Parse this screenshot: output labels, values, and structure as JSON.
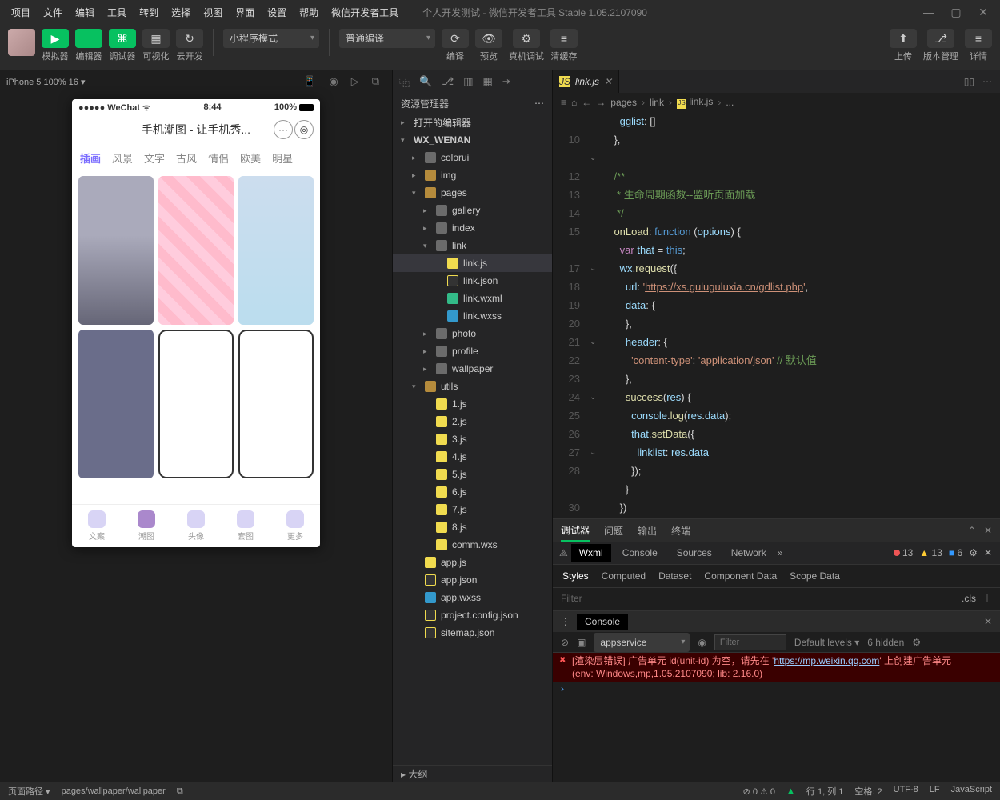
{
  "menubar": {
    "items": [
      "项目",
      "文件",
      "编辑",
      "工具",
      "转到",
      "选择",
      "视图",
      "界面",
      "设置",
      "帮助",
      "微信开发者工具"
    ],
    "title": "个人开发测试 - 微信开发者工具 Stable 1.05.2107090"
  },
  "toolbar": {
    "buttons": [
      {
        "name": "simulator",
        "label": "模拟器",
        "glyph": "▶",
        "cls": "green"
      },
      {
        "name": "editor",
        "label": "编辑器",
        "glyph": "</>",
        "cls": "green"
      },
      {
        "name": "debugger",
        "label": "调试器",
        "glyph": "⌘",
        "cls": "green"
      },
      {
        "name": "visualize",
        "label": "可视化",
        "glyph": "▦",
        "cls": "gray"
      },
      {
        "name": "cloud",
        "label": "云开发",
        "glyph": "↻",
        "cls": "gray"
      }
    ],
    "mode": "小程序模式",
    "compile": "普通编译",
    "mid": [
      {
        "name": "compile-btn",
        "label": "编译",
        "glyph": "⟳"
      },
      {
        "name": "preview-btn",
        "label": "预览",
        "glyph": "👁"
      },
      {
        "name": "remote-btn",
        "label": "真机调试",
        "glyph": "⚙"
      },
      {
        "name": "cache-btn",
        "label": "清缓存",
        "glyph": "≡"
      }
    ],
    "right": [
      {
        "name": "upload-btn",
        "label": "上传",
        "glyph": "⬆"
      },
      {
        "name": "version-btn",
        "label": "版本管理",
        "glyph": "⎇"
      },
      {
        "name": "detail-btn",
        "label": "详情",
        "glyph": "≡"
      }
    ]
  },
  "simulator": {
    "device": "iPhone 5 100% 16 ▾",
    "phone": {
      "carrier": "●●●●● WeChat ᯤ",
      "time": "8:44",
      "battery": "100%",
      "title": "手机潮图 - 让手机秀...",
      "tabs": [
        "插画",
        "风景",
        "文字",
        "古风",
        "情侣",
        "欧美",
        "明星"
      ],
      "tabbar": [
        "文案",
        "潮图",
        "头像",
        "套图",
        "更多"
      ]
    }
  },
  "files": {
    "header": "资源管理器",
    "nodes": [
      {
        "d": 0,
        "c": "▸",
        "t": "打开的编辑器",
        "cls": ""
      },
      {
        "d": 0,
        "c": "▾",
        "t": "WX_WENAN",
        "cls": "",
        "bold": true
      },
      {
        "d": 1,
        "c": "▸",
        "t": "colorui",
        "cls": "ic-folder"
      },
      {
        "d": 1,
        "c": "▸",
        "t": "img",
        "cls": "ic-folder-o"
      },
      {
        "d": 1,
        "c": "▾",
        "t": "pages",
        "cls": "ic-folder-o"
      },
      {
        "d": 2,
        "c": "▸",
        "t": "gallery",
        "cls": "ic-folder"
      },
      {
        "d": 2,
        "c": "▸",
        "t": "index",
        "cls": "ic-folder"
      },
      {
        "d": 2,
        "c": "▾",
        "t": "link",
        "cls": "ic-folder"
      },
      {
        "d": 3,
        "c": "",
        "t": "link.js",
        "cls": "ic-js",
        "cur": true
      },
      {
        "d": 3,
        "c": "",
        "t": "link.json",
        "cls": "ic-json"
      },
      {
        "d": 3,
        "c": "",
        "t": "link.wxml",
        "cls": "ic-wxml"
      },
      {
        "d": 3,
        "c": "",
        "t": "link.wxss",
        "cls": "ic-wxss"
      },
      {
        "d": 2,
        "c": "▸",
        "t": "photo",
        "cls": "ic-folder"
      },
      {
        "d": 2,
        "c": "▸",
        "t": "profile",
        "cls": "ic-folder"
      },
      {
        "d": 2,
        "c": "▸",
        "t": "wallpaper",
        "cls": "ic-folder"
      },
      {
        "d": 1,
        "c": "▾",
        "t": "utils",
        "cls": "ic-folder-o"
      },
      {
        "d": 2,
        "c": "",
        "t": "1.js",
        "cls": "ic-js"
      },
      {
        "d": 2,
        "c": "",
        "t": "2.js",
        "cls": "ic-js"
      },
      {
        "d": 2,
        "c": "",
        "t": "3.js",
        "cls": "ic-js"
      },
      {
        "d": 2,
        "c": "",
        "t": "4.js",
        "cls": "ic-js"
      },
      {
        "d": 2,
        "c": "",
        "t": "5.js",
        "cls": "ic-js"
      },
      {
        "d": 2,
        "c": "",
        "t": "6.js",
        "cls": "ic-js"
      },
      {
        "d": 2,
        "c": "",
        "t": "7.js",
        "cls": "ic-js"
      },
      {
        "d": 2,
        "c": "",
        "t": "8.js",
        "cls": "ic-js"
      },
      {
        "d": 2,
        "c": "",
        "t": "comm.wxs",
        "cls": "ic-wxs"
      },
      {
        "d": 1,
        "c": "",
        "t": "app.js",
        "cls": "ic-js"
      },
      {
        "d": 1,
        "c": "",
        "t": "app.json",
        "cls": "ic-json"
      },
      {
        "d": 1,
        "c": "",
        "t": "app.wxss",
        "cls": "ic-wxss"
      },
      {
        "d": 1,
        "c": "",
        "t": "project.config.json",
        "cls": "ic-json"
      },
      {
        "d": 1,
        "c": "",
        "t": "sitemap.json",
        "cls": "ic-json"
      }
    ],
    "outline": "▸ 大纲"
  },
  "editor": {
    "tab": "link.js",
    "crumbs": [
      "pages",
      "link",
      "link.js",
      "..."
    ],
    "lines": [
      "",
      "10",
      "",
      "12",
      "13",
      "14",
      "15",
      "",
      "17",
      "18",
      "19",
      "20",
      "21",
      "22",
      "23",
      "24",
      "25",
      "26",
      "27",
      "28",
      "",
      "30"
    ],
    "folds": {
      "2": "⌄",
      "8": "⌄",
      "12": "⌄",
      "15": "⌄",
      "18": "⌄"
    },
    "code": [
      "      <span class='c-v'>gglist</span><span class='c-p'>: []</span>",
      "    <span class='c-p'>},</span>",
      "",
      "    <span class='c-c'>/**</span>",
      "<span class='c-c'>     * 生命周期函数--监听页面加载</span>",
      "<span class='c-c'>     */</span>",
      "    <span class='c-f'>onLoad</span><span class='c-p'>: </span><span class='c-t'>function</span> <span class='c-p'>(</span><span class='c-v'>options</span><span class='c-p'>) {</span>",
      "      <span class='c-k'>var</span> <span class='c-v'>that</span> <span class='c-p'>=</span> <span class='c-t'>this</span><span class='c-p'>;</span>",
      "      <span class='c-v'>wx</span><span class='c-p'>.</span><span class='c-f'>request</span><span class='c-p'>({</span>",
      "        <span class='c-v'>url</span><span class='c-p'>: </span><span class='c-s'>'</span><span class='c-url'>https://xs.guluguluxia.cn/gdlist.php</span><span class='c-s'>'</span><span class='c-p'>,</span>",
      "        <span class='c-v'>data</span><span class='c-p'>: {</span>",
      "        <span class='c-p'>},</span>",
      "        <span class='c-v'>header</span><span class='c-p'>: {</span>",
      "          <span class='c-s'>'content-type'</span><span class='c-p'>: </span><span class='c-s'>'application/json'</span> <span class='c-c'>// 默认值</span>",
      "        <span class='c-p'>},</span>",
      "        <span class='c-f'>success</span><span class='c-p'>(</span><span class='c-v'>res</span><span class='c-p'>) {</span>",
      "          <span class='c-v'>console</span><span class='c-p'>.</span><span class='c-f'>log</span><span class='c-p'>(</span><span class='c-v'>res</span><span class='c-p'>.</span><span class='c-v'>data</span><span class='c-p'>);</span>",
      "          <span class='c-v'>that</span><span class='c-p'>.</span><span class='c-f'>setData</span><span class='c-p'>({</span>",
      "            <span class='c-v'>linklist</span><span class='c-p'>: </span><span class='c-v'>res</span><span class='c-p'>.</span><span class='c-v'>data</span>",
      "          <span class='c-p'>});</span>",
      "        <span class='c-p'>}</span>",
      "      <span class='c-p'>})</span>"
    ]
  },
  "debugger": {
    "tabs": [
      "调试器",
      "问题",
      "输出",
      "终端"
    ],
    "devtabs": [
      "Wxml",
      "Console",
      "Sources",
      "Network"
    ],
    "stats": {
      "err": "13",
      "warn": "13",
      "info": "6"
    },
    "styletabs": [
      "Styles",
      "Computed",
      "Dataset",
      "Component Data",
      "Scope Data"
    ],
    "filter": "Filter",
    "cls": ".cls",
    "console": {
      "title": "Console",
      "context": "appservice",
      "filter": "Filter",
      "levels": "Default levels ▾",
      "hidden": "6 hidden",
      "err1": "[渲染层错误] 广告单元 id(unit-id) 为空，请先在 '",
      "errlink": "https://mp.weixin.qq.com",
      "err1b": "' 上创建广告单元",
      "err2": "(env: Windows,mp,1.05.2107090; lib: 2.16.0)"
    }
  },
  "status": {
    "left": "页面路径 ▾",
    "path": "pages/wallpaper/wallpaper",
    "diag": "⊘ 0 ⚠ 0",
    "right": [
      "行 1, 列 1",
      "空格: 2",
      "UTF-8",
      "LF",
      "JavaScript"
    ]
  }
}
